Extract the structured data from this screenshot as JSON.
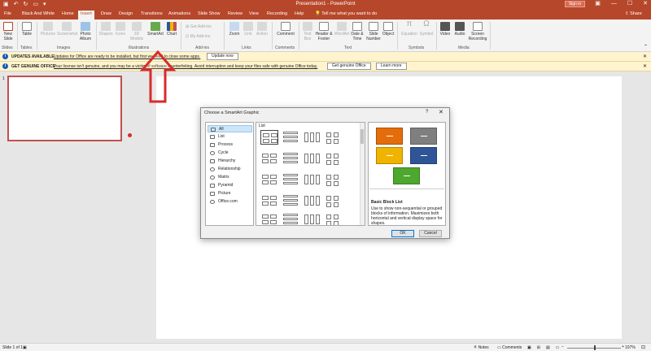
{
  "titlebar": {
    "title": "Presentation1 - PowerPoint",
    "signin": "Sign in",
    "qat_icons": [
      "save-icon",
      "undo-icon",
      "redo-icon",
      "present-icon"
    ],
    "controls": [
      "restore-ribbon-icon",
      "minimize-icon",
      "maximize-icon",
      "close-icon"
    ]
  },
  "tabs": {
    "file": "File",
    "black_and_white": "Black And White",
    "home": "Home",
    "insert": "Insert",
    "draw": "Draw",
    "design": "Design",
    "transitions": "Transitions",
    "animations": "Animations",
    "slide_show": "Slide Show",
    "review": "Review",
    "view": "View",
    "recording": "Recording",
    "help": "Help",
    "tellme": "Tell me what you want to do",
    "share": "Share"
  },
  "ribbon": {
    "new_slide": "New Slide",
    "table": "Table",
    "pictures": "Pictures",
    "screenshot": "Screenshot",
    "photo_album": "Photo Album",
    "shapes": "Shapes",
    "icons": "Icons",
    "models_3d": "3D Models",
    "smartart": "SmartArt",
    "chart": "Chart",
    "get_addins": "Get Add-ins",
    "my_addins": "My Add-ins",
    "zoom": "Zoom",
    "link": "Link",
    "action": "Action",
    "comment": "Comment",
    "text_box": "Text Box",
    "header_footer": "Header & Footer",
    "wordart": "WordArt",
    "date_time": "Date & Time",
    "slide_number": "Slide Number",
    "object": "Object",
    "equation": "Equation",
    "symbol": "Symbol",
    "video": "Video",
    "audio": "Audio",
    "screen_recording": "Screen Recording",
    "groups": {
      "slides": "Slides",
      "tables": "Tables",
      "images": "Images",
      "illustrations": "Illustrations",
      "addins": "Add-ins",
      "links": "Links",
      "comments": "Comments",
      "text": "Text",
      "symbols": "Symbols",
      "media": "Media"
    }
  },
  "messages": {
    "updates": {
      "head": "UPDATES AVAILABLE",
      "text": "Updates for Office are ready to be installed, but first we need to close some apps.",
      "button": "Update now"
    },
    "genuine": {
      "head": "GET GENUINE OFFICE",
      "text": "Your license isn't genuine, and you may be a victim of software counterfeiting. Avoid interruption and keep your files safe with genuine Office today.",
      "button1": "Get genuine Office",
      "button2": "Learn more"
    }
  },
  "slide_pane": {
    "slide_number": "1"
  },
  "dialog": {
    "title": "Choose a SmartArt Graphic",
    "help": "?",
    "close": "✕",
    "categories": [
      "All",
      "List",
      "Process",
      "Cycle",
      "Hierarchy",
      "Relationship",
      "Matrix",
      "Pyramid",
      "Picture",
      "Office.com"
    ],
    "gallery_header": "List",
    "preview_name": "Basic Block List",
    "preview_desc": "Use to show non-sequential or grouped blocks of information. Maximizes both horizontal and vertical display space for shapes.",
    "preview_colors": {
      "orange": "#e46c0a",
      "gray": "#7f7f7f",
      "gold": "#f0b400",
      "blue": "#2f5597",
      "green": "#4ea72e"
    },
    "ok": "OK",
    "cancel": "Cancel"
  },
  "status": {
    "slide_of": "Slide 1 of 1",
    "notes": "Notes",
    "comments": "Comments",
    "zoom": "107%"
  },
  "colors": {
    "accent": "#b7472a",
    "arrow": "#d92b2b"
  }
}
